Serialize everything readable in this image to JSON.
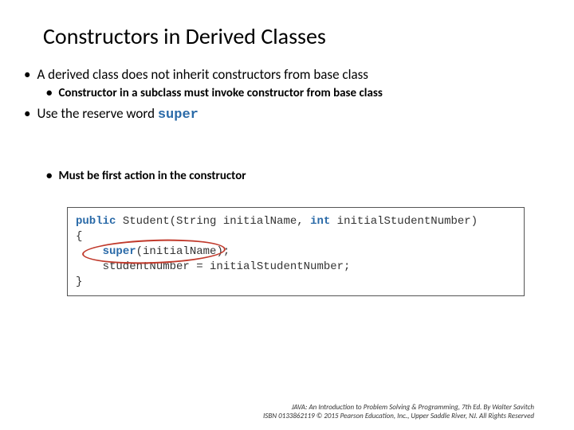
{
  "title": "Constructors in Derived Classes",
  "bullets": {
    "b1": "A derived class does not inherit constructors from base class",
    "b1a": "Constructor in a subclass must invoke constructor from base class",
    "b2_pre": "Use the reserve word ",
    "b2_code": "super",
    "b3": "Must be first action in the constructor"
  },
  "code": {
    "kw_public": "public",
    "kw_int": "int",
    "kw_super": "super",
    "l1_a": " Student(String initialName, ",
    "l1_b": " initialStudentNumber)",
    "l2": "{",
    "l3_a": "    ",
    "l3_b": "(initialName);",
    "l4": "    studentNumber = initialStudentNumber;",
    "l5": "}"
  },
  "footer": {
    "line1": "JAVA: An Introduction to Problem Solving & Programming, 7th Ed. By Walter Savitch",
    "line2": "ISBN 0133862119 © 2015 Pearson Education, Inc., Upper Saddle River, NJ. All Rights Reserved"
  }
}
